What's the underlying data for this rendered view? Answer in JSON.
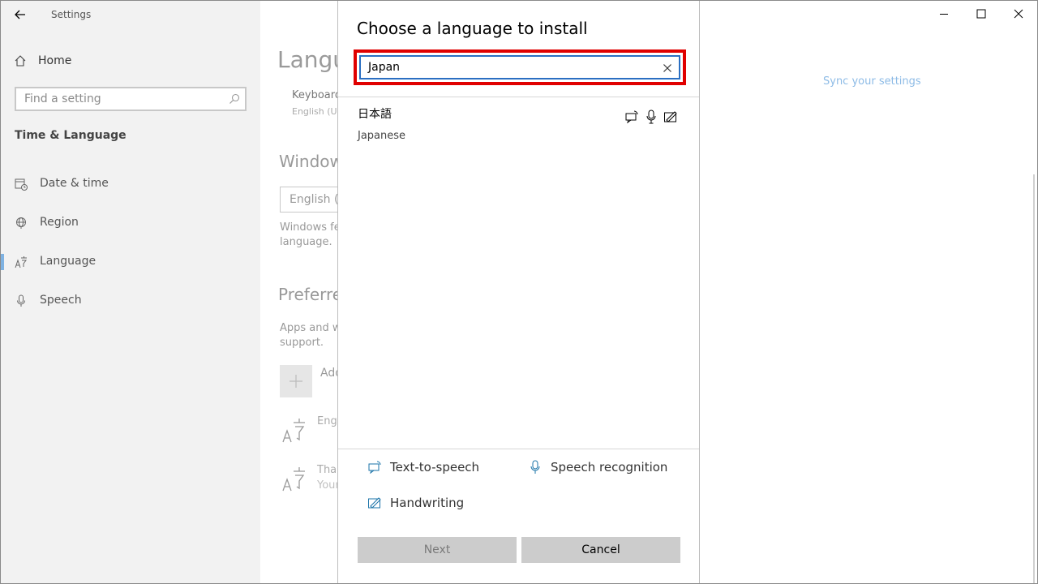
{
  "app": {
    "title": "Settings"
  },
  "sidebar": {
    "home_label": "Home",
    "search_placeholder": "Find a setting",
    "section": "Time & Language",
    "items": [
      {
        "label": "Date & time",
        "icon": "calendar-clock-icon"
      },
      {
        "label": "Region",
        "icon": "globe-icon"
      },
      {
        "label": "Language",
        "icon": "language-icon",
        "selected": true
      },
      {
        "label": "Speech",
        "icon": "microphone-icon"
      }
    ]
  },
  "main": {
    "page_title": "Langu",
    "keyboard_label": "Keyboard",
    "keyboard_sub": "English (U",
    "windows_display_heading": "Window",
    "display_language_value": "English (U",
    "windows_desc_line1": "Windows fe",
    "windows_desc_line2": "language.",
    "preferred_heading": "Preferre",
    "preferred_desc_line1": "Apps and w",
    "preferred_desc_line2": "support.",
    "add_language_label": "Add",
    "languages": [
      {
        "name": "Engl",
        "sub": ""
      },
      {
        "name": "Thai",
        "sub": "Your"
      }
    ],
    "sync_link": "Sync your settings"
  },
  "dialog": {
    "title": "Choose a language to install",
    "search_value": "Japan",
    "result": {
      "native": "日本語",
      "english": "Japanese"
    },
    "legend": {
      "tts": "Text-to-speech",
      "speech": "Speech recognition",
      "handwriting": "Handwriting"
    },
    "next_label": "Next",
    "cancel_label": "Cancel"
  },
  "colors": {
    "accent": "#2b6fc2",
    "highlight": "#e00000",
    "link": "#8dbbe6",
    "feature_icon": "#1a73a8"
  }
}
